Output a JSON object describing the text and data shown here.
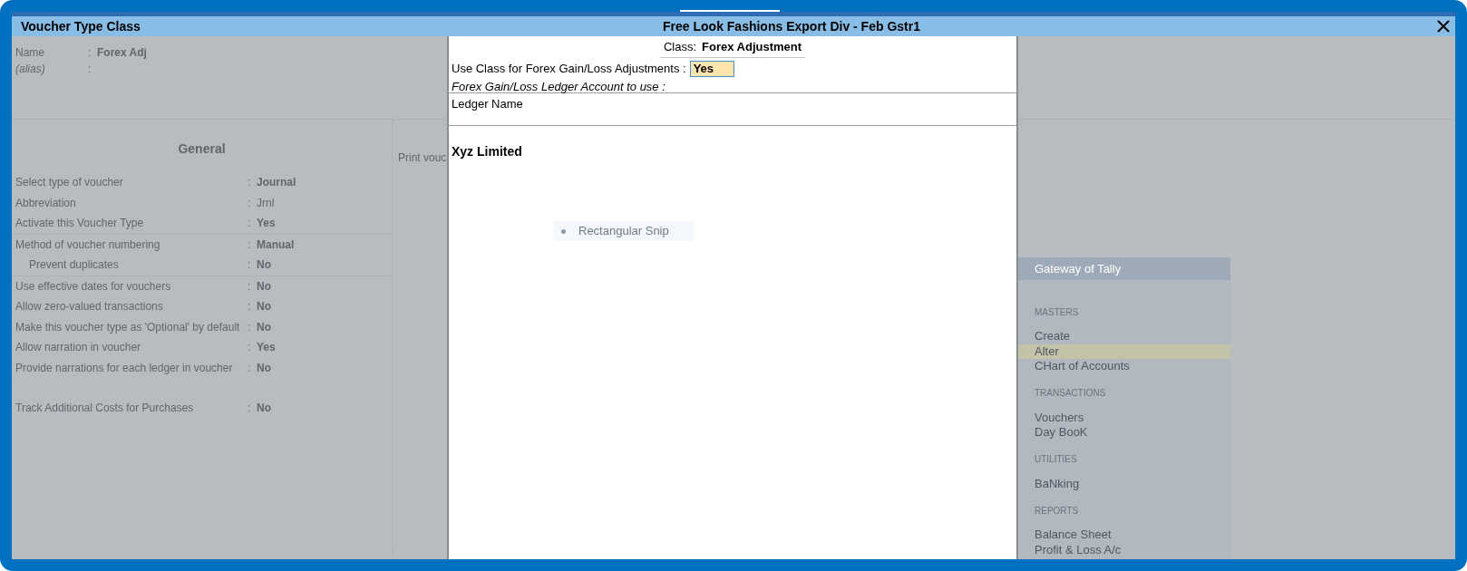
{
  "window": {
    "title": "Voucher Type Class",
    "company": "Free Look Fashions  Export Div - Feb Gstr1"
  },
  "form": {
    "separator": ":",
    "name_label": "Name",
    "name_value": "Forex Adj",
    "alias_label": "(alias)",
    "section_title": "General",
    "print_label": "Print vouc",
    "groups": [
      [
        {
          "label": "Select type of voucher",
          "value": "Journal",
          "bold": true,
          "indented": false
        },
        {
          "label": "Abbreviation",
          "value": "Jrnl",
          "bold": false,
          "indented": false
        },
        {
          "label": "Activate this Voucher Type",
          "value": "Yes",
          "bold": true,
          "indented": false
        }
      ],
      [
        {
          "label": "Method of voucher numbering",
          "value": "Manual",
          "bold": true,
          "indented": false
        },
        {
          "label": "Prevent duplicates",
          "value": "No",
          "bold": true,
          "indented": true
        }
      ],
      [
        {
          "label": "Use effective dates for vouchers",
          "value": "No",
          "bold": true,
          "indented": false
        },
        {
          "label": "Allow zero-valued transactions",
          "value": "No",
          "bold": true,
          "indented": false
        },
        {
          "label": "Make this voucher type as 'Optional' by default",
          "value": "No",
          "bold": true,
          "indented": false
        },
        {
          "label": "Allow narration in voucher",
          "value": "Yes",
          "bold": true,
          "indented": false
        },
        {
          "label": "Provide narrations for each ledger in voucher",
          "value": "No",
          "bold": true,
          "indented": false
        }
      ],
      [
        {
          "label": "Track Additional Costs for Purchases",
          "value": "No",
          "bold": true,
          "indented": false
        }
      ]
    ]
  },
  "dialog": {
    "class_label": "Class:",
    "class_value": "Forex Adjustment",
    "use_label": "Use Class for Forex Gain/Loss Adjustments :",
    "use_value": "Yes",
    "ledger_prompt": "Forex Gain/Loss Ledger Account to use :",
    "column": "Ledger Name",
    "rows": [
      "Xyz Limited"
    ]
  },
  "snip": {
    "label": "Rectangular Snip"
  },
  "gateway": {
    "title": "Gateway of Tally",
    "sections": [
      {
        "heading": "MASTERS",
        "items": [
          {
            "label": "Create",
            "selected": false
          },
          {
            "label": "Alter",
            "selected": true
          },
          {
            "label": "CHart of Accounts",
            "selected": false
          }
        ]
      },
      {
        "heading": "TRANSACTIONS",
        "items": [
          {
            "label": "Vouchers",
            "selected": false
          },
          {
            "label": "Day BooK",
            "selected": false
          }
        ]
      },
      {
        "heading": "UTILITIES",
        "items": [
          {
            "label": "BaNking",
            "selected": false
          }
        ]
      },
      {
        "heading": "REPORTS",
        "items": [
          {
            "label": "Balance Sheet",
            "selected": false
          },
          {
            "label": "Profit & Loss A/c",
            "selected": false
          }
        ]
      }
    ]
  }
}
